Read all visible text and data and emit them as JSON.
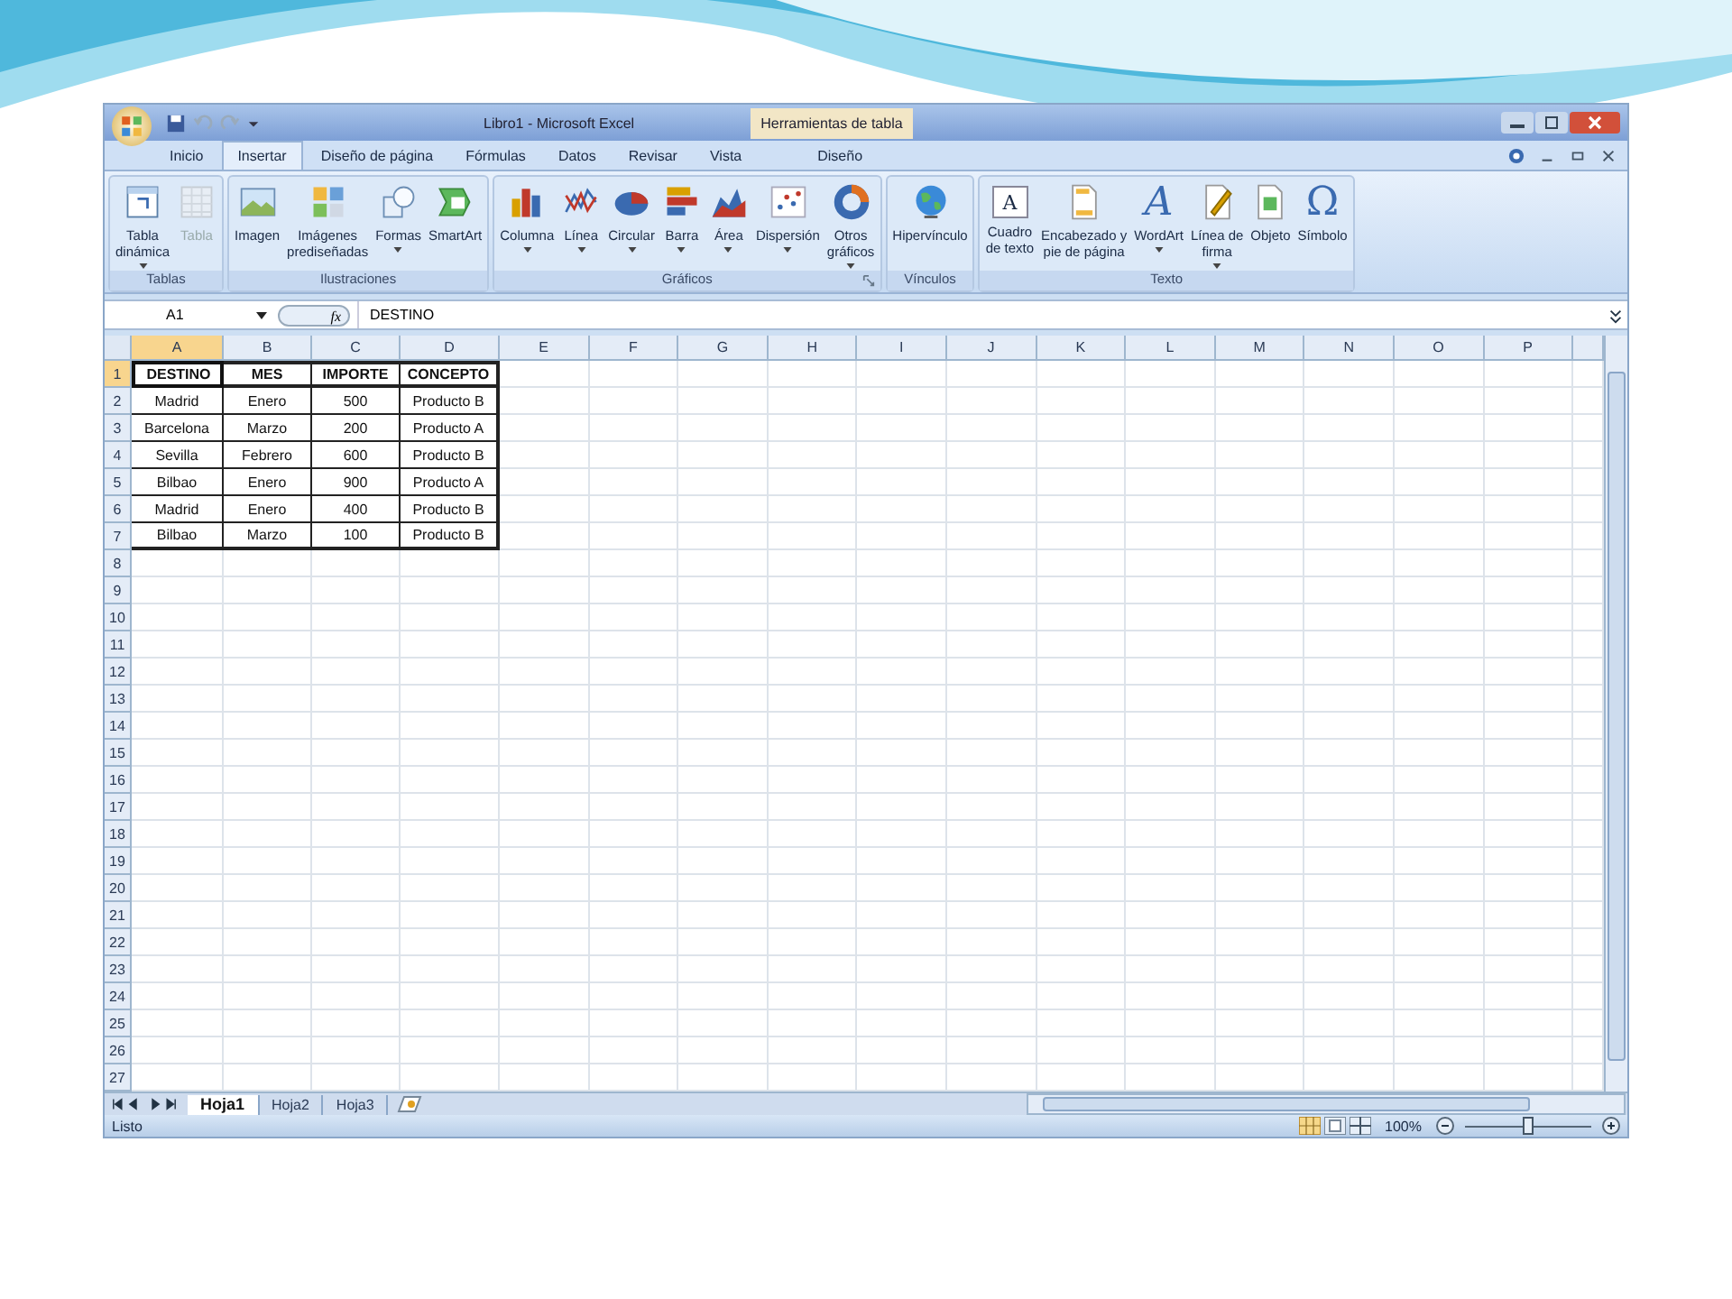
{
  "window": {
    "title": "Libro1 - Microsoft Excel",
    "context_title": "Herramientas de tabla"
  },
  "tabs": [
    {
      "label": "Inicio",
      "selected": false
    },
    {
      "label": "Insertar",
      "selected": true
    },
    {
      "label": "Diseño de página",
      "selected": false
    },
    {
      "label": "Fórmulas",
      "selected": false
    },
    {
      "label": "Datos",
      "selected": false
    },
    {
      "label": "Revisar",
      "selected": false
    },
    {
      "label": "Vista",
      "selected": false
    },
    {
      "label": "Diseño",
      "selected": false
    }
  ],
  "ribbon": {
    "groups": [
      {
        "name": "Tablas",
        "launcher": false,
        "buttons": [
          {
            "lines": [
              "Tabla",
              "dinámica"
            ],
            "dropdown": true,
            "disabled": false
          },
          {
            "lines": [
              "Tabla"
            ],
            "dropdown": false,
            "disabled": true
          }
        ]
      },
      {
        "name": "Ilustraciones",
        "launcher": false,
        "buttons": [
          {
            "lines": [
              "Imagen"
            ],
            "dropdown": false,
            "disabled": false
          },
          {
            "lines": [
              "Imágenes",
              "prediseñadas"
            ],
            "dropdown": false,
            "disabled": false
          },
          {
            "lines": [
              "Formas"
            ],
            "dropdown": true,
            "disabled": false
          },
          {
            "lines": [
              "SmartArt"
            ],
            "dropdown": false,
            "disabled": false
          }
        ]
      },
      {
        "name": "Gráficos",
        "launcher": true,
        "buttons": [
          {
            "lines": [
              "Columna"
            ],
            "dropdown": true,
            "disabled": false
          },
          {
            "lines": [
              "Línea"
            ],
            "dropdown": true,
            "disabled": false
          },
          {
            "lines": [
              "Circular"
            ],
            "dropdown": true,
            "disabled": false
          },
          {
            "lines": [
              "Barra"
            ],
            "dropdown": true,
            "disabled": false
          },
          {
            "lines": [
              "Área"
            ],
            "dropdown": true,
            "disabled": false
          },
          {
            "lines": [
              "Dispersión"
            ],
            "dropdown": true,
            "disabled": false
          },
          {
            "lines": [
              "Otros",
              "gráficos"
            ],
            "dropdown": true,
            "disabled": false
          }
        ]
      },
      {
        "name": "Vínculos",
        "launcher": false,
        "buttons": [
          {
            "lines": [
              "Hipervínculo"
            ],
            "dropdown": false,
            "disabled": false
          }
        ]
      },
      {
        "name": "Texto",
        "launcher": false,
        "buttons": [
          {
            "lines": [
              "Cuadro",
              "de texto"
            ],
            "dropdown": false,
            "disabled": false,
            "glyph": "A"
          },
          {
            "lines": [
              "Encabezado y",
              "pie de página"
            ],
            "dropdown": false,
            "disabled": false
          },
          {
            "lines": [
              "WordArt"
            ],
            "dropdown": true,
            "disabled": false,
            "glyph": "A"
          },
          {
            "lines": [
              "Línea de",
              "firma"
            ],
            "dropdown": true,
            "disabled": false
          },
          {
            "lines": [
              "Objeto"
            ],
            "dropdown": false,
            "disabled": false
          },
          {
            "lines": [
              "Símbolo"
            ],
            "dropdown": false,
            "disabled": false,
            "glyph": "Ω"
          }
        ]
      }
    ]
  },
  "formula_bar": {
    "name_box": "A1",
    "function_label": "fx",
    "value": "DESTINO"
  },
  "grid": {
    "columns": [
      {
        "label": "A",
        "selected": true
      },
      {
        "label": "B",
        "selected": false
      },
      {
        "label": "C",
        "selected": false
      },
      {
        "label": "D",
        "selected": false
      },
      {
        "label": "E",
        "selected": false
      },
      {
        "label": "F",
        "selected": false
      },
      {
        "label": "G",
        "selected": false
      },
      {
        "label": "H",
        "selected": false
      },
      {
        "label": "I",
        "selected": false
      },
      {
        "label": "J",
        "selected": false
      },
      {
        "label": "K",
        "selected": false
      },
      {
        "label": "L",
        "selected": false
      },
      {
        "label": "M",
        "selected": false
      },
      {
        "label": "N",
        "selected": false
      },
      {
        "label": "O",
        "selected": false
      },
      {
        "label": "P",
        "selected": false
      }
    ],
    "rows": [
      {
        "label": "1",
        "selected": true,
        "cells": [
          "DESTINO",
          "MES",
          "IMPORTE",
          "CONCEPTO"
        ]
      },
      {
        "label": "2",
        "selected": false,
        "cells": [
          "Madrid",
          "Enero",
          "500",
          "Producto B"
        ]
      },
      {
        "label": "3",
        "selected": false,
        "cells": [
          "Barcelona",
          "Marzo",
          "200",
          "Producto A"
        ]
      },
      {
        "label": "4",
        "selected": false,
        "cells": [
          "Sevilla",
          "Febrero",
          "600",
          "Producto B"
        ]
      },
      {
        "label": "5",
        "selected": false,
        "cells": [
          "Bilbao",
          "Enero",
          "900",
          "Producto A"
        ]
      },
      {
        "label": "6",
        "selected": false,
        "cells": [
          "Madrid",
          "Enero",
          "400",
          "Producto B"
        ]
      },
      {
        "label": "7",
        "selected": false,
        "cells": [
          "Bilbao",
          "Marzo",
          "100",
          "Producto B"
        ]
      },
      {
        "label": "8",
        "selected": false
      },
      {
        "label": "9",
        "selected": false
      },
      {
        "label": "10",
        "selected": false
      },
      {
        "label": "11",
        "selected": false
      },
      {
        "label": "12",
        "selected": false
      },
      {
        "label": "13",
        "selected": false
      },
      {
        "label": "14",
        "selected": false
      },
      {
        "label": "15",
        "selected": false
      },
      {
        "label": "16",
        "selected": false
      },
      {
        "label": "17",
        "selected": false
      },
      {
        "label": "18",
        "selected": false
      },
      {
        "label": "19",
        "selected": false
      },
      {
        "label": "20",
        "selected": false
      },
      {
        "label": "21",
        "selected": false
      },
      {
        "label": "22",
        "selected": false
      },
      {
        "label": "23",
        "selected": false
      },
      {
        "label": "24",
        "selected": false
      },
      {
        "label": "25",
        "selected": false
      },
      {
        "label": "26",
        "selected": false
      },
      {
        "label": "27",
        "selected": false
      }
    ]
  },
  "sheets": [
    {
      "label": "Hoja1",
      "selected": true
    },
    {
      "label": "Hoja2",
      "selected": false
    },
    {
      "label": "Hoja3",
      "selected": false
    }
  ],
  "status_bar": {
    "text": "Listo",
    "zoom": "100%",
    "zoom_slider": {
      "level": 0.5
    }
  }
}
